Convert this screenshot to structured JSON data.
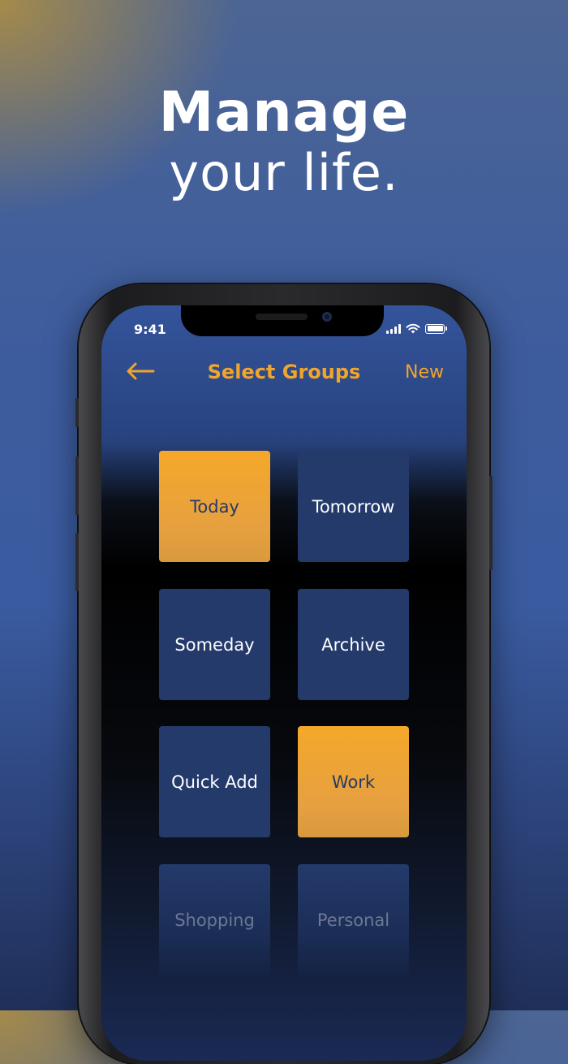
{
  "headline": {
    "bold": "Manage",
    "light": "your life."
  },
  "status_bar": {
    "time": "9:41"
  },
  "navbar": {
    "title": "Select Groups",
    "new_label": "New"
  },
  "groups": [
    {
      "label": "Today",
      "selected": true
    },
    {
      "label": "Tomorrow",
      "selected": false
    },
    {
      "label": "Someday",
      "selected": false
    },
    {
      "label": "Archive",
      "selected": false
    },
    {
      "label": "Quick Add",
      "selected": false
    },
    {
      "label": "Work",
      "selected": true
    },
    {
      "label": "Shopping",
      "selected": false
    },
    {
      "label": "Personal",
      "selected": false
    }
  ],
  "colors": {
    "accent": "#f0a52c",
    "tile": "#243a6b",
    "background": "#3a5ba0"
  },
  "icons": {
    "back": "arrow-left-icon",
    "signal": "cellular-signal-icon",
    "wifi": "wifi-icon",
    "battery": "battery-icon"
  }
}
